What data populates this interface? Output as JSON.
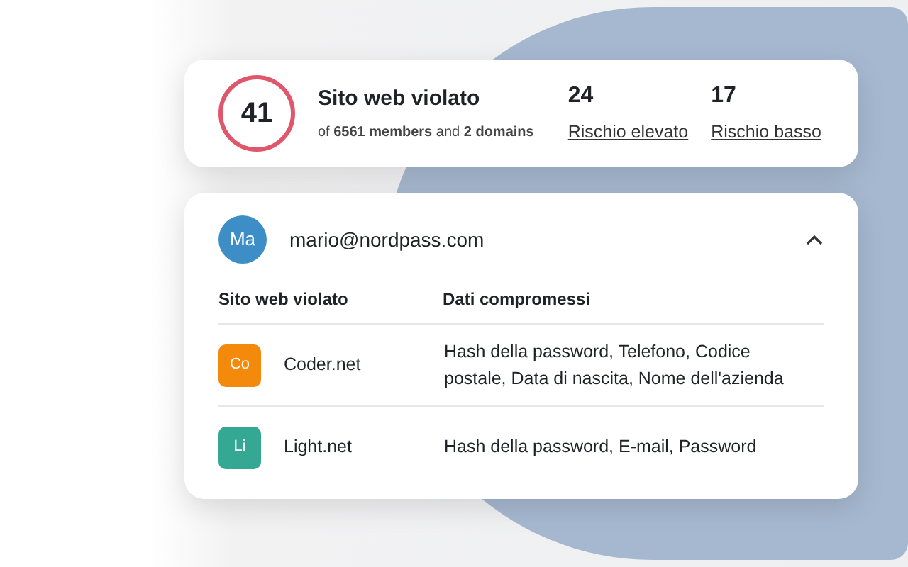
{
  "summary": {
    "count": "41",
    "title": "Sito web violato",
    "subtitle": "of **6561 members** and **2 domains**",
    "stats": [
      {
        "value": "24",
        "label": "Rischio elevato"
      },
      {
        "value": "17",
        "label": "Rischio basso"
      }
    ]
  },
  "account": {
    "avatar": "Ma",
    "email": "mario@nordpass.com",
    "expanded": true
  },
  "table": {
    "columns": [
      "Sito web violato",
      "Dati compromessi"
    ],
    "rows": [
      {
        "initials": "Co",
        "color": "#f48a0c",
        "site": "Coder.net",
        "data": "Hash della password, Telefono, Codice postale, Data di nascita, Nome dell'azienda"
      },
      {
        "initials": "Li",
        "color": "#34a893",
        "site": "Light.net",
        "data": "Hash della password, E-mail, Password"
      }
    ]
  }
}
